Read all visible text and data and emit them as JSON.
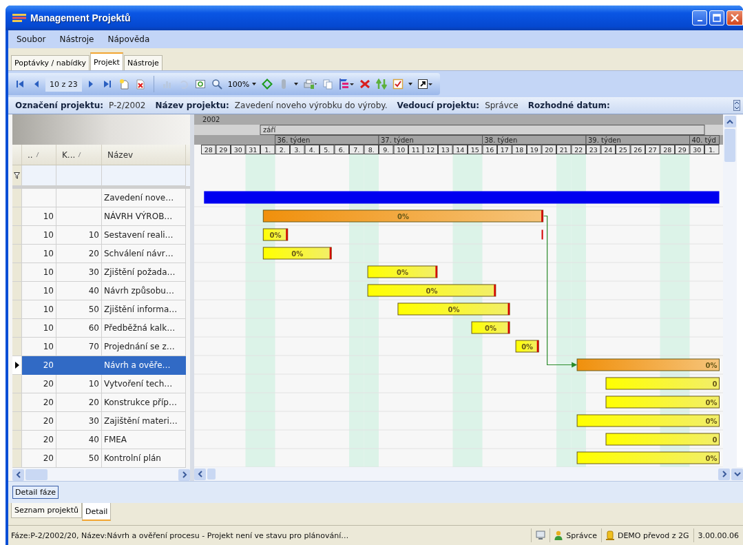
{
  "window": {
    "title": "Management Projektů"
  },
  "menu": [
    {
      "label": "Soubor"
    },
    {
      "label": "Nástroje"
    },
    {
      "label": "Nápověda"
    }
  ],
  "tabs": [
    {
      "label": "Poptávky / nabídky",
      "selected": false
    },
    {
      "label": "Projekt",
      "selected": true
    },
    {
      "label": "Nástroje",
      "selected": false
    }
  ],
  "toolbar": {
    "record_position": "10 z 23",
    "zoom": "100%"
  },
  "project_info": [
    {
      "label": "Označení projektu:",
      "value": "P-2/2002"
    },
    {
      "label": "Název projektu:",
      "value": "Zavedení noveho výrobku do výroby."
    },
    {
      "label": "Vedoucí projektu:",
      "value": "Správce"
    },
    {
      "label": "Rozhodné datum:"
    }
  ],
  "grid": {
    "columns": [
      {
        "label": "..",
        "sorted": true
      },
      {
        "label": "K...",
        "sorted": true
      },
      {
        "label": "Název",
        "sorted": false
      }
    ],
    "rows": [
      {
        "name": "Zavedení nove…",
        "selected": false,
        "bar": {
          "kind": "summary"
        }
      },
      {
        "column_1": "10",
        "name": "NÁVRH VÝROB…",
        "selected": false,
        "bar": {
          "kind": "phase",
          "label": "0%"
        }
      },
      {
        "column_1": "10",
        "column_2": "10",
        "name": "Sestavení reali…",
        "selected": false,
        "bar": {
          "kind": "task",
          "label": "0%"
        }
      },
      {
        "column_1": "10",
        "column_2": "20",
        "name": "Schválení návr…",
        "selected": false,
        "bar": {
          "kind": "task",
          "label": "0%"
        }
      },
      {
        "column_1": "10",
        "column_2": "30",
        "name": "Zjištění požada…",
        "selected": false,
        "bar": {
          "kind": "task",
          "label": "0%"
        }
      },
      {
        "column_1": "10",
        "column_2": "40",
        "name": "Návrh způsobu…",
        "selected": false,
        "bar": {
          "kind": "task",
          "label": "0%"
        }
      },
      {
        "column_1": "10",
        "column_2": "50",
        "name": "Zjištění informa…",
        "selected": false,
        "bar": {
          "kind": "task",
          "label": "0%"
        }
      },
      {
        "column_1": "10",
        "column_2": "60",
        "name": "Předběžná kalk…",
        "selected": false,
        "bar": {
          "kind": "task",
          "label": "0%"
        }
      },
      {
        "column_1": "10",
        "column_2": "70",
        "name": "Projednání se z…",
        "selected": false,
        "bar": {
          "kind": "task",
          "label": "0%"
        }
      },
      {
        "column_1": "20",
        "name": "Návrh a ověře…",
        "selected": true,
        "bar": {
          "kind": "phase",
          "label": "0%"
        }
      },
      {
        "column_1": "20",
        "column_2": "10",
        "name": "Vytvoření tech…",
        "selected": false,
        "bar": {
          "kind": "task",
          "label": "0"
        }
      },
      {
        "column_1": "20",
        "column_2": "20",
        "name": "Konstrukce příp…",
        "selected": false,
        "bar": {
          "kind": "task",
          "label": "0%"
        }
      },
      {
        "column_1": "20",
        "column_2": "30",
        "name": "Zajištění materi…",
        "selected": false,
        "bar": {
          "kind": "task",
          "label": "0%"
        }
      },
      {
        "column_1": "20",
        "column_2": "40",
        "name": "FMEA",
        "selected": false,
        "bar": {
          "kind": "task",
          "label": "0"
        }
      },
      {
        "column_1": "20",
        "column_2": "50",
        "name": "Kontrolní plán",
        "selected": false,
        "bar": {
          "kind": "task",
          "label": "0%"
        }
      }
    ]
  },
  "gantt": {
    "year": "2002",
    "month": "září",
    "weeks": [
      "36. týden",
      "37. týden",
      "38. týden",
      "39. týden",
      "40. týd"
    ],
    "days": [
      "28",
      "29",
      "30",
      "31",
      "1.",
      "2.",
      "3.",
      "4.",
      "5.",
      "6.",
      "7.",
      "8.",
      "9.",
      "10",
      "11",
      "12",
      "13",
      "14",
      "15",
      "16",
      "17",
      "18",
      "19",
      "20",
      "21",
      "22",
      "23",
      "24",
      "25",
      "26",
      "27",
      "28",
      "29",
      "30",
      "1."
    ]
  },
  "detail_panel": {
    "label": "Detail fáze"
  },
  "bottom_tabs": [
    {
      "label": "Seznam projektů",
      "selected": false
    },
    {
      "label": "Detail",
      "selected": true
    }
  ],
  "status_bar": {
    "message": "Fáze:P-2/2002/20, Název:Návrh a ověření procesu - Projekt není ve stavu pro plánování…",
    "user": "Správce",
    "database": "DEMO převod z 2G",
    "version": "3.00.00.06"
  }
}
